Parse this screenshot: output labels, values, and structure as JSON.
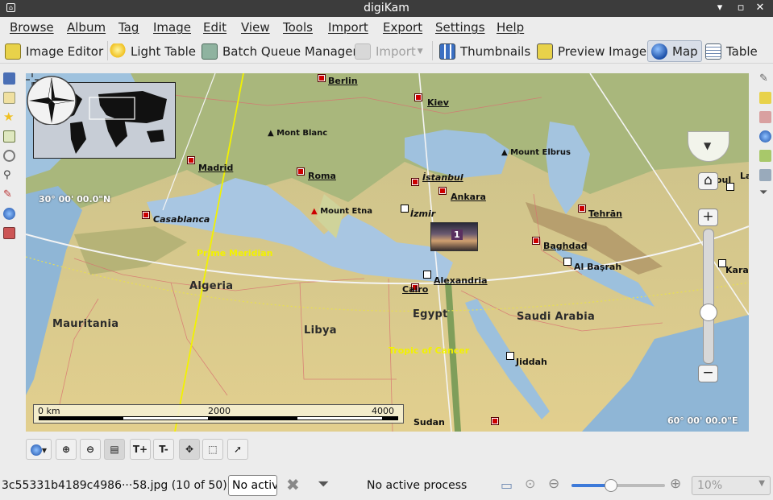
{
  "window": {
    "title": "digiKam"
  },
  "menu": [
    "Browse",
    "Album",
    "Tag",
    "Image",
    "Edit",
    "View",
    "Tools",
    "Import",
    "Export",
    "Settings",
    "Help"
  ],
  "toolbar": {
    "image_editor": "Image Editor",
    "light_table": "Light Table",
    "batch_queue": "Batch Queue Manager",
    "import": "Import",
    "thumbnails": "Thumbnails",
    "preview": "Preview Image",
    "map": "Map",
    "table": "Table"
  },
  "map": {
    "cities": {
      "berlin": "Berlin",
      "kiev": "Kiev",
      "madrid": "Madrid",
      "roma": "Roma",
      "istanbul": "İstanbul",
      "ankara": "Ankara",
      "izmir": "İzmir",
      "casablanca": "Casablanca",
      "tehran": "Tehrān",
      "baghdad": "Baghdad",
      "al_basrah": "Al Başrah",
      "cairo": "Cairo",
      "alexandria": "Alexandria",
      "jiddah": "Jiddah",
      "sudan": "Sudan",
      "karachi": "Karac",
      "kabul": "oul",
      "lahore": "La"
    },
    "mountains": {
      "mont_blanc": "Mont Blanc",
      "mount_etna": "Mount Etna",
      "mount_elbrus": "Mount Elbrus"
    },
    "regions": {
      "algeria": "Algeria",
      "libya": "Libya",
      "egypt": "Egypt",
      "mauritania": "Mauritania",
      "saudi_arabia": "Saudi Arabia"
    },
    "lines": {
      "prime_meridian": "Prime Meridian",
      "tropic_of_cancer": "Tropic of Cancer"
    },
    "coords": {
      "lat": "30° 00' 00.0\"N",
      "lon": "60° 00' 00.0\"E"
    },
    "scale": {
      "start": "0 km",
      "mid": "2000",
      "end": "4000"
    },
    "photo_count": "1"
  },
  "status": {
    "filename": "3c55331b4189c4986···58.jpg (10 of 50)",
    "process_combo": "No activ",
    "process_text": "No active process",
    "zoom": "10%"
  }
}
